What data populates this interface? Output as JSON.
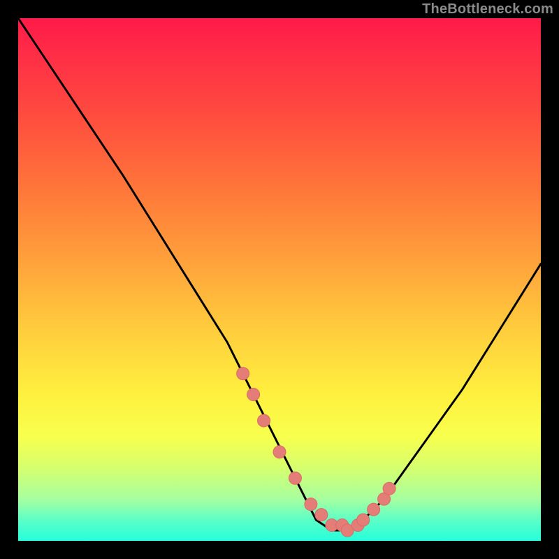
{
  "watermark": "TheBottleneck.com",
  "colors": {
    "background": "#000000",
    "curve_stroke": "#000000",
    "marker_fill": "#e47d77",
    "marker_stroke": "#dc6a63"
  },
  "chart_data": {
    "type": "line",
    "title": "",
    "xlabel": "",
    "ylabel": "",
    "xlim": [
      0,
      100
    ],
    "ylim": [
      0,
      100
    ],
    "x": [
      0,
      5,
      10,
      15,
      20,
      25,
      30,
      35,
      40,
      45,
      50,
      55,
      57,
      60,
      63,
      65,
      70,
      75,
      80,
      85,
      90,
      95,
      100
    ],
    "values": [
      100,
      92.5,
      85,
      77.5,
      70,
      62,
      54,
      46,
      38,
      28,
      18,
      8,
      4,
      2,
      2,
      3,
      8,
      15,
      22,
      29,
      37,
      45,
      53
    ],
    "markers": {
      "x": [
        43,
        45,
        47,
        50,
        53,
        56,
        58,
        60,
        62,
        63,
        65,
        66,
        68,
        70,
        71
      ],
      "y": [
        32,
        28,
        23,
        17,
        12,
        7,
        5,
        3,
        3,
        2,
        3,
        4,
        6,
        8,
        10
      ]
    }
  }
}
